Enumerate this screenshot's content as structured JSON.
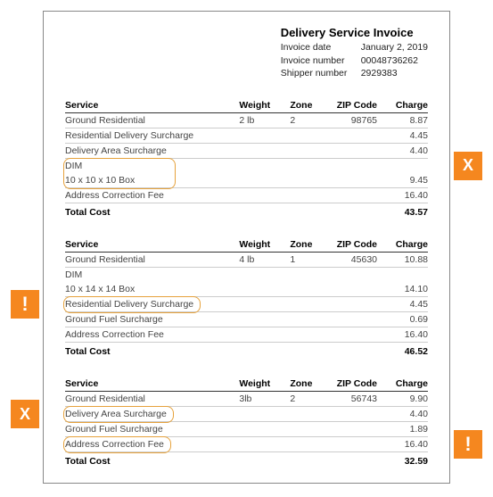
{
  "header": {
    "title": "Delivery Service Invoice",
    "rows": [
      {
        "label": "Invoice date",
        "value": "January 2, 2019"
      },
      {
        "label": "Invoice number",
        "value": "00048736262"
      },
      {
        "label": "Shipper number",
        "value": "2929383"
      }
    ]
  },
  "tables": {
    "headers": {
      "service": "Service",
      "weight": "Weight",
      "zone": "Zone",
      "zip": "ZIP Code",
      "charge": "Charge"
    },
    "totalLabel": "Total Cost"
  },
  "sections": [
    {
      "rows": [
        {
          "service": "Ground Residential",
          "weight": "2 lb",
          "zone": "2",
          "zip": "98765",
          "charge": "8.87"
        },
        {
          "service": "Residential Delivery Surcharge",
          "charge": "4.45"
        },
        {
          "service": "Delivery Area Surcharge",
          "charge": "4.40"
        },
        {
          "dim_top": "DIM",
          "dim_sub": "10 x 10 x 10 Box",
          "charge": "9.45",
          "highlight": "right-x"
        },
        {
          "service": "Address Correction Fee",
          "charge": "16.40"
        }
      ],
      "total": "43.57"
    },
    {
      "rows": [
        {
          "service": "Ground Residential",
          "weight": "4 lb",
          "zone": "1",
          "zip": "45630",
          "charge": "10.88"
        },
        {
          "dim_top": "DIM",
          "dim_sub": "10 x 14 x 14 Box",
          "charge": "14.10"
        },
        {
          "service": "Residential Delivery Surcharge",
          "charge": "4.45",
          "highlight": "left-exclaim"
        },
        {
          "service": "Ground Fuel Surcharge",
          "charge": "0.69"
        },
        {
          "service": "Address Correction Fee",
          "charge": "16.40"
        }
      ],
      "total": "46.52"
    },
    {
      "rows": [
        {
          "service": "Ground Residential",
          "weight": "3lb",
          "zone": "2",
          "zip": "56743",
          "charge": "9.90"
        },
        {
          "service": "Delivery Area Surcharge",
          "charge": "4.40",
          "highlight": "left-x"
        },
        {
          "service": "Ground Fuel Surcharge",
          "charge": "1.89"
        },
        {
          "service": "Address Correction Fee",
          "charge": "16.40",
          "highlight": "right-exclaim"
        }
      ],
      "total": "32.59"
    }
  ],
  "callouts": [
    {
      "glyph": "X",
      "side": "right",
      "row": "0.3",
      "kind": "x"
    },
    {
      "glyph": "!",
      "side": "left",
      "row": "1.2",
      "kind": "exclaim"
    },
    {
      "glyph": "X",
      "side": "left",
      "row": "2.1",
      "kind": "x"
    },
    {
      "glyph": "!",
      "side": "right",
      "row": "2.3",
      "kind": "exclaim"
    }
  ]
}
